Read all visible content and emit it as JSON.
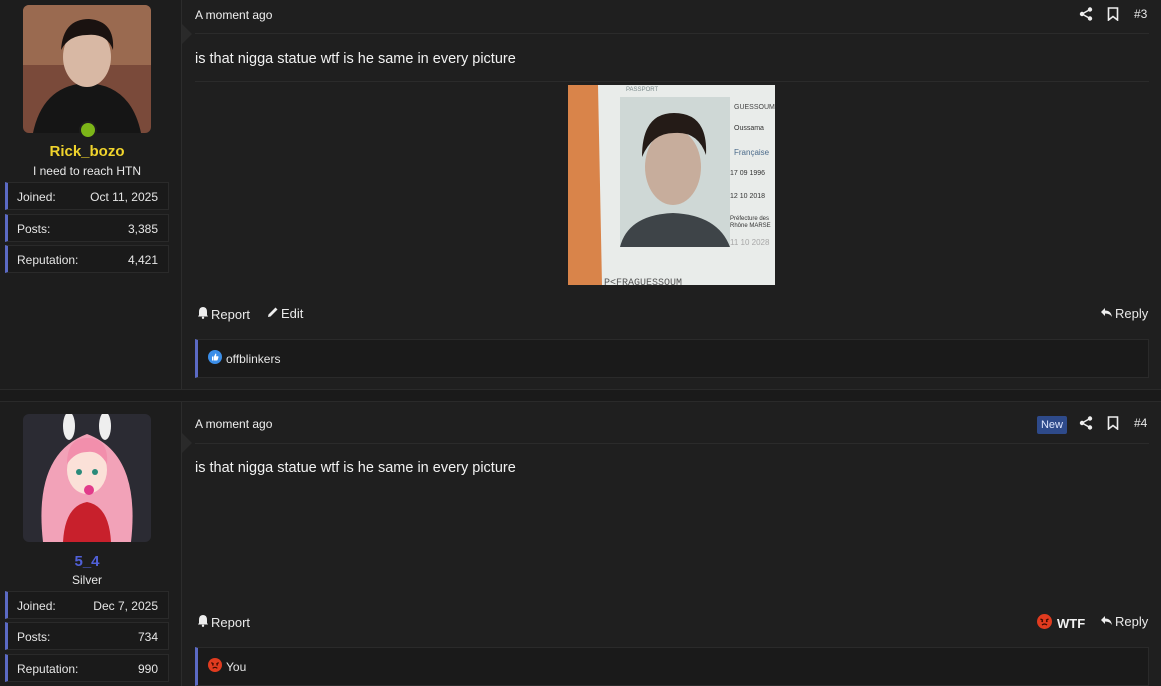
{
  "posts": [
    {
      "user": {
        "name": "Rick_bozo",
        "name_color": "#f0d42c",
        "title": "I need to reach HTN",
        "online": true,
        "stats": [
          {
            "label": "Joined:",
            "value": "Oct 11, 2025"
          },
          {
            "label": "Posts:",
            "value": "3,385"
          },
          {
            "label": "Reputation:",
            "value": "4,421"
          }
        ]
      },
      "time": "A moment ago",
      "number": "#3",
      "message": "is that nigga statue wtf is he same in every picture",
      "attachment_text": "PASSPORT GUESSOUM Oussama Française 17 09 1996 12 10 2018 Préfecture des Rhône MARSE 11 10 2028 P<FRAGUESSOUM",
      "actions": {
        "report": "Report",
        "edit": "Edit",
        "reply": "Reply"
      },
      "reactions": {
        "user": "offblinkers",
        "type": "like-icon"
      }
    },
    {
      "user": {
        "name": "5_4",
        "name_color": "#5060d8",
        "title": "Silver",
        "stats": [
          {
            "label": "Joined:",
            "value": "Dec 7, 2025"
          },
          {
            "label": "Posts:",
            "value": "734"
          },
          {
            "label": "Reputation:",
            "value": "990"
          }
        ]
      },
      "time": "A moment ago",
      "badge": "New",
      "number": "#4",
      "message": "is that nigga statue wtf is he same in every picture",
      "actions": {
        "report": "Report",
        "wtf": "WTF",
        "reply": "Reply"
      },
      "reactions": {
        "user": "You",
        "type": "angry-icon"
      }
    }
  ],
  "colors": {
    "accent": "#5b6ac4",
    "online": "#7cb518",
    "wtf": "#e03b1f"
  }
}
